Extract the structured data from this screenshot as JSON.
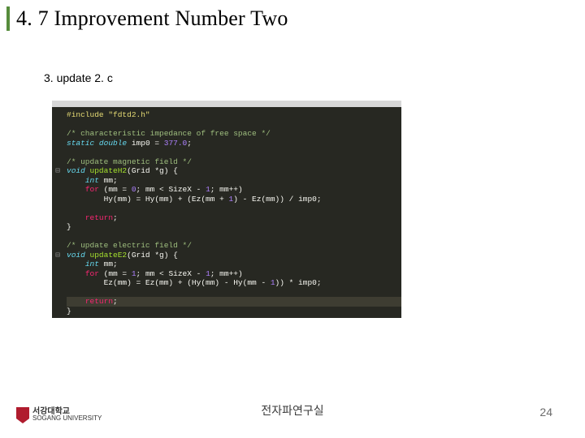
{
  "title": "4. 7 Improvement Number Two",
  "subtitle": "3. update 2. c",
  "footer": {
    "center": "전자파연구실",
    "page": "24"
  },
  "logo": {
    "korean": "서강대학교",
    "english": "SOGANG UNIVERSITY"
  },
  "code": {
    "gutter_marks": [
      "",
      "",
      "",
      "",
      "",
      "",
      "⊟",
      "",
      "",
      "",
      "",
      "",
      "",
      "",
      "",
      "⊟",
      "",
      "",
      "",
      "",
      "",
      "",
      "",
      ""
    ],
    "lines": [
      {
        "cls": "",
        "html": "<span class='c-pre'>#include </span><span class='c-pre'>\"fdtd2.h\"</span>"
      },
      {
        "cls": "",
        "html": ""
      },
      {
        "cls": "",
        "html": "<span class='c-com'>/* characteristic impedance of free space */</span>"
      },
      {
        "cls": "",
        "html": "<span class='c-kw'>static</span> <span class='c-kw'>double</span> imp0 = <span class='c-num'>377.0</span>;"
      },
      {
        "cls": "",
        "html": ""
      },
      {
        "cls": "",
        "html": "<span class='c-com'>/* update magnetic field */</span>"
      },
      {
        "cls": "",
        "html": "<span class='c-kw'>void</span> <span class='c-fn'>updateH2</span>(Grid *g) {"
      },
      {
        "cls": "",
        "html": "    <span class='c-kw'>int</span> mm;"
      },
      {
        "cls": "",
        "html": "    <span class='c-kw2'>for</span> (mm = <span class='c-num'>0</span>; mm &lt; SizeX - <span class='c-num'>1</span>; mm++)"
      },
      {
        "cls": "",
        "html": "        Hy(mm) = Hy(mm) + (Ez(mm + <span class='c-num'>1</span>) - Ez(mm)) / imp0;"
      },
      {
        "cls": "",
        "html": ""
      },
      {
        "cls": "",
        "html": "    <span class='c-kw2'>return</span>;"
      },
      {
        "cls": "",
        "html": "}"
      },
      {
        "cls": "",
        "html": ""
      },
      {
        "cls": "",
        "html": "<span class='c-com'>/* update electric field */</span>"
      },
      {
        "cls": "",
        "html": "<span class='c-kw'>void</span> <span class='c-fn'>updateE2</span>(Grid *g) {"
      },
      {
        "cls": "",
        "html": "    <span class='c-kw'>int</span> mm;"
      },
      {
        "cls": "",
        "html": "    <span class='c-kw2'>for</span> (mm = <span class='c-num'>1</span>; mm &lt; SizeX - <span class='c-num'>1</span>; mm++)"
      },
      {
        "cls": "",
        "html": "        Ez(mm) = Ez(mm) + (Hy(mm) - Hy(mm - <span class='c-num'>1</span>)) * imp0;"
      },
      {
        "cls": "",
        "html": ""
      },
      {
        "cls": "hl",
        "html": "    <span class='c-kw2'>return</span>;"
      },
      {
        "cls": "",
        "html": "}"
      }
    ]
  }
}
